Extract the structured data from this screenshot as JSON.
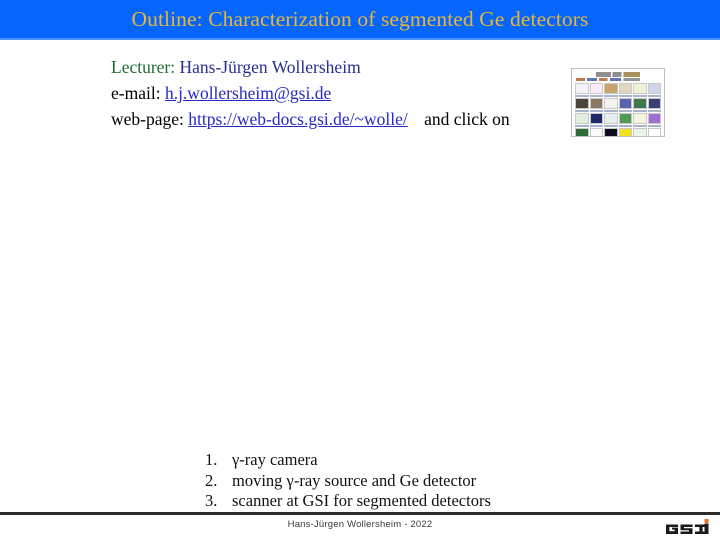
{
  "slide": {
    "title": "Outline: Characterization of segmented Ge detectors",
    "title_bar_color": "#0666FB",
    "title_text_color": "#E8B63A"
  },
  "info": {
    "lecturer_label": "Lecturer:",
    "lecturer_name": "Hans-Jürgen Wollersheim",
    "lecturer_label_color": "#1F6B2E",
    "lecturer_name_color": "#262E8E",
    "email_label": "e-mail:",
    "email_value": "h.j.wollersheim@gsi.de",
    "webpage_label": "web-page:",
    "webpage_value": "https://web-docs.gsi.de/~wolle/",
    "webpage_trailing": "and click on",
    "link_color": "#2828C8"
  },
  "outline": {
    "items": [
      {
        "number": "1.",
        "text": "γ-ray camera"
      },
      {
        "number": "2.",
        "text": "moving γ-ray source and Ge detector"
      },
      {
        "number": "3.",
        "text": "scanner at GSI for segmented detectors"
      }
    ]
  },
  "footer": {
    "text": "Hans-Jürgen Wollersheim - 2022",
    "logo_text": "GSI",
    "logo_accent_color": "#E8732B"
  }
}
